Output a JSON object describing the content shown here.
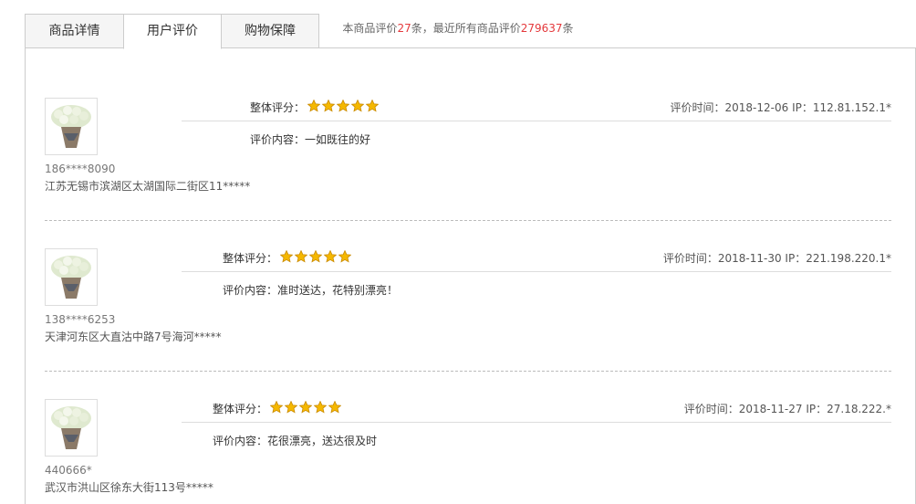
{
  "tabs": [
    "商品详情",
    "用户评价",
    "购物保障"
  ],
  "summary": {
    "prefix": "本商品评价",
    "count": "27",
    "middle": "条，最近所有商品评价",
    "total": "279637",
    "suffix": "条"
  },
  "reviews": [
    {
      "user_id": "186****8090",
      "address": "江苏无锡市滨湖区太湖国际二街区11*****",
      "rating_label": "整体评分：",
      "stars": 5,
      "time_label": "评价时间：",
      "date": "2018-12-06",
      "ip_label": "IP：",
      "ip": "112.81.152.1*",
      "content_label": "评价内容：",
      "content": "一如既往的好"
    },
    {
      "user_id": "138****6253",
      "address": "天津河东区大直沽中路7号海河*****",
      "rating_label": "整体评分：",
      "stars": 5,
      "time_label": "评价时间：",
      "date": "2018-11-30",
      "ip_label": "IP：",
      "ip": "221.198.220.1*",
      "content_label": "评价内容：",
      "content": "准时送达，花特别漂亮！"
    },
    {
      "user_id": "440666*",
      "address": "武汉市洪山区徐东大街113号*****",
      "rating_label": "整体评分：",
      "stars": 5,
      "time_label": "评价时间：",
      "date": "2018-11-27",
      "ip_label": "IP：",
      "ip": "27.18.222.*",
      "content_label": "评价内容：",
      "content": "花很漂亮，送达很及时"
    }
  ],
  "colors": {
    "accent_red": "#e4393c",
    "star": "#f5b800"
  },
  "icons": {
    "avatar": "bouquet-image",
    "star": "star-icon"
  }
}
